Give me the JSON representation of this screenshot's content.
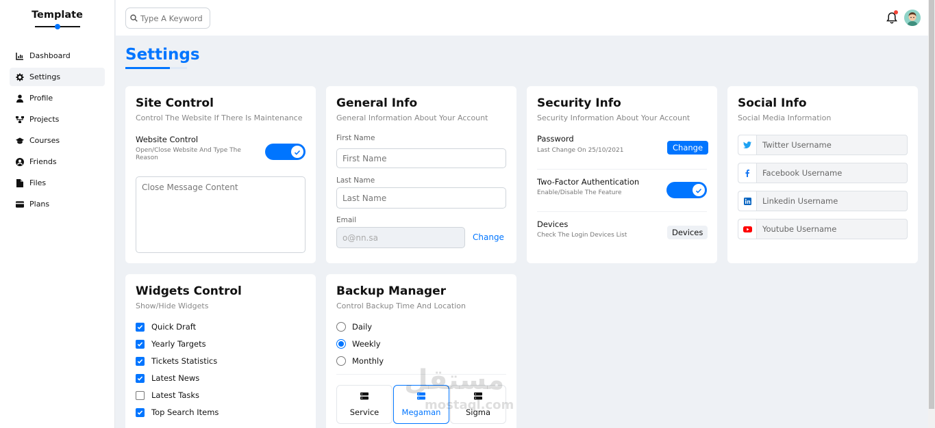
{
  "brand": "Template",
  "sidebar": {
    "items": [
      {
        "label": "Dashboard",
        "icon": "chart-icon"
      },
      {
        "label": "Settings",
        "icon": "gear-icon"
      },
      {
        "label": "Profile",
        "icon": "user-icon"
      },
      {
        "label": "Projects",
        "icon": "diagram-icon"
      },
      {
        "label": "Courses",
        "icon": "graduation-cap-icon"
      },
      {
        "label": "Friends",
        "icon": "user-circle-icon"
      },
      {
        "label": "Files",
        "icon": "file-icon"
      },
      {
        "label": "Plans",
        "icon": "credit-card-icon"
      }
    ],
    "active": "Settings"
  },
  "topbar": {
    "search_placeholder": "Type A Keyword"
  },
  "page": {
    "title": "Settings"
  },
  "site_control": {
    "title": "Site Control",
    "subtitle": "Control The Website If There Is Maintenance",
    "website_control_label": "Website Control",
    "website_control_desc": "Open/Close Website And Type The Reason",
    "website_control_on": true,
    "message_placeholder": "Close Message Content"
  },
  "general_info": {
    "title": "General Info",
    "subtitle": "General Information About Your Account",
    "first_name_label": "First Name",
    "first_name_placeholder": "First Name",
    "last_name_label": "Last Name",
    "last_name_placeholder": "Last Name",
    "email_label": "Email",
    "email_value": "o@nn.sa",
    "change_label": "Change"
  },
  "security_info": {
    "title": "Security Info",
    "subtitle": "Security Information About Your Account",
    "password_label": "Password",
    "password_desc": "Last Change On 25/10/2021",
    "password_button": "Change",
    "tfa_label": "Two-Factor Authentication",
    "tfa_desc": "Enable/Disable The Feature",
    "tfa_on": true,
    "devices_label": "Devices",
    "devices_desc": "Check The Login Devices List",
    "devices_button": "Devices"
  },
  "social_info": {
    "title": "Social Info",
    "subtitle": "Social Media Information",
    "fields": [
      {
        "placeholder": "Twitter Username",
        "icon": "twitter-icon",
        "color": "#1da1f2"
      },
      {
        "placeholder": "Facebook Username",
        "icon": "facebook-icon",
        "color": "#1877f2"
      },
      {
        "placeholder": "Linkedin Username",
        "icon": "linkedin-icon",
        "color": "#0a66c2"
      },
      {
        "placeholder": "Youtube Username",
        "icon": "youtube-icon",
        "color": "#ff0000"
      }
    ]
  },
  "widgets_control": {
    "title": "Widgets Control",
    "subtitle": "Show/Hide Widgets",
    "items": [
      {
        "label": "Quick Draft",
        "checked": true
      },
      {
        "label": "Yearly Targets",
        "checked": true
      },
      {
        "label": "Tickets Statistics",
        "checked": true
      },
      {
        "label": "Latest News",
        "checked": true
      },
      {
        "label": "Latest Tasks",
        "checked": false
      },
      {
        "label": "Top Search Items",
        "checked": true
      }
    ]
  },
  "backup_manager": {
    "title": "Backup Manager",
    "subtitle": "Control Backup Time And Location",
    "options": [
      {
        "label": "Daily",
        "selected": false
      },
      {
        "label": "Weekly",
        "selected": true
      },
      {
        "label": "Monthly",
        "selected": false
      }
    ],
    "servers": [
      {
        "label": "Service",
        "active": false
      },
      {
        "label": "Megaman",
        "active": true
      },
      {
        "label": "Sigma",
        "active": false
      }
    ]
  },
  "watermark": {
    "arabic": "مستقل",
    "latin": "mostaql.com"
  },
  "colors": {
    "accent": "#0075ff",
    "background": "#eef1f5"
  }
}
